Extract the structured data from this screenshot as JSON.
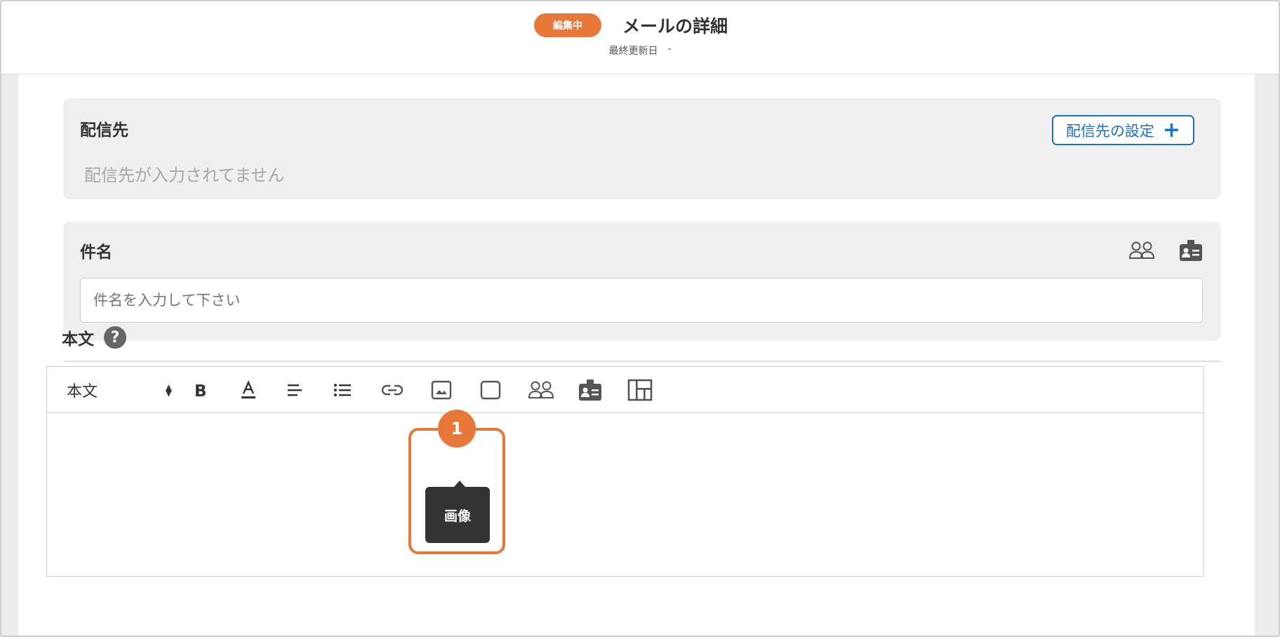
{
  "header": {
    "status_badge": "編集中",
    "title": "メールの詳細",
    "last_updated_label": "最終更新日",
    "last_updated_value": "-"
  },
  "destination": {
    "label": "配信先",
    "empty_text": "配信先が入力されてません",
    "button_label": "配信先の設定"
  },
  "subject": {
    "label": "件名",
    "placeholder": "件名を入力して下さい",
    "icons": [
      "people-icon",
      "id-badge-icon"
    ]
  },
  "body": {
    "label": "本文",
    "help_icon": "help-icon",
    "toolbar": {
      "style_value": "本文",
      "tools": [
        "bold-icon",
        "text-color-icon",
        "align-icon",
        "list-icon",
        "link-icon",
        "image-icon",
        "frame-icon",
        "people-icon",
        "id-badge-icon",
        "layout-icon"
      ]
    },
    "tooltip": "画像"
  },
  "annotation": {
    "number": "1",
    "color": "#e8773a"
  },
  "colors": {
    "accent": "#e8773a",
    "link_blue": "#1e6fc6"
  }
}
